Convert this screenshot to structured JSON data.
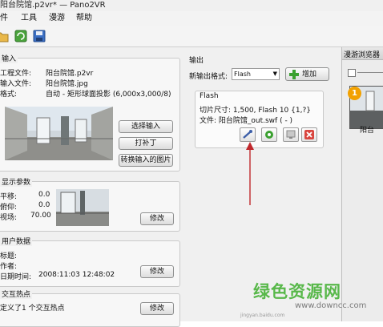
{
  "window": {
    "title": "阳台院馆.p2vr* — Pano2VR"
  },
  "menu": [
    "件",
    "工具",
    "漫游",
    "帮助"
  ],
  "input": {
    "section": "输入",
    "project_label": "工程文件:",
    "project_value": "阳台院馆.p2vr",
    "input_label": "输入文件:",
    "input_value": "阳台院馆.jpg",
    "format_label": "格式:",
    "format_value": "自动 - 矩形球面投影 (6,000x3,000/8)",
    "btn_select": "选择输入",
    "btn_patch": "打补丁",
    "btn_convert": "转换输入的图片"
  },
  "display": {
    "section": "显示参数",
    "pan_label": "平移:",
    "pan_value": "0.0",
    "tilt_label": "俯仰:",
    "tilt_value": "0.0",
    "fov_label": "视场:",
    "fov_value": "70.00",
    "btn_modify": "修改"
  },
  "userdata": {
    "section": "用户数据",
    "title_label": "标题:",
    "author_label": "作者:",
    "date_label": "日期时间:",
    "date_value": "2008:11:03 12:48:02",
    "btn_modify": "修改"
  },
  "hotspots": {
    "section": "交互热点",
    "defined_text": "定义了1 个交互热点",
    "btn_modify": "修改"
  },
  "output": {
    "section": "输出",
    "new_format_label": "新输出格式:",
    "format_selected": "Flash",
    "btn_add": "增加",
    "flash": {
      "title": "Flash",
      "tile_size": "切片尺寸: 1,500, Flash 10 {1,?}",
      "file": "文件: 阳台院馆_out.swf ( - )"
    }
  },
  "tour_browser": {
    "title": "漫游浏览器",
    "badge": "1",
    "thumb_label": "阳台"
  },
  "watermark": {
    "brand": "绿色资源网",
    "url": "www.downcc.com",
    "small": "jingyan.baidu.com"
  },
  "colors": {
    "arrow": "#c0282c",
    "add_green": "#3aa02f",
    "badge": "#f2a100"
  }
}
